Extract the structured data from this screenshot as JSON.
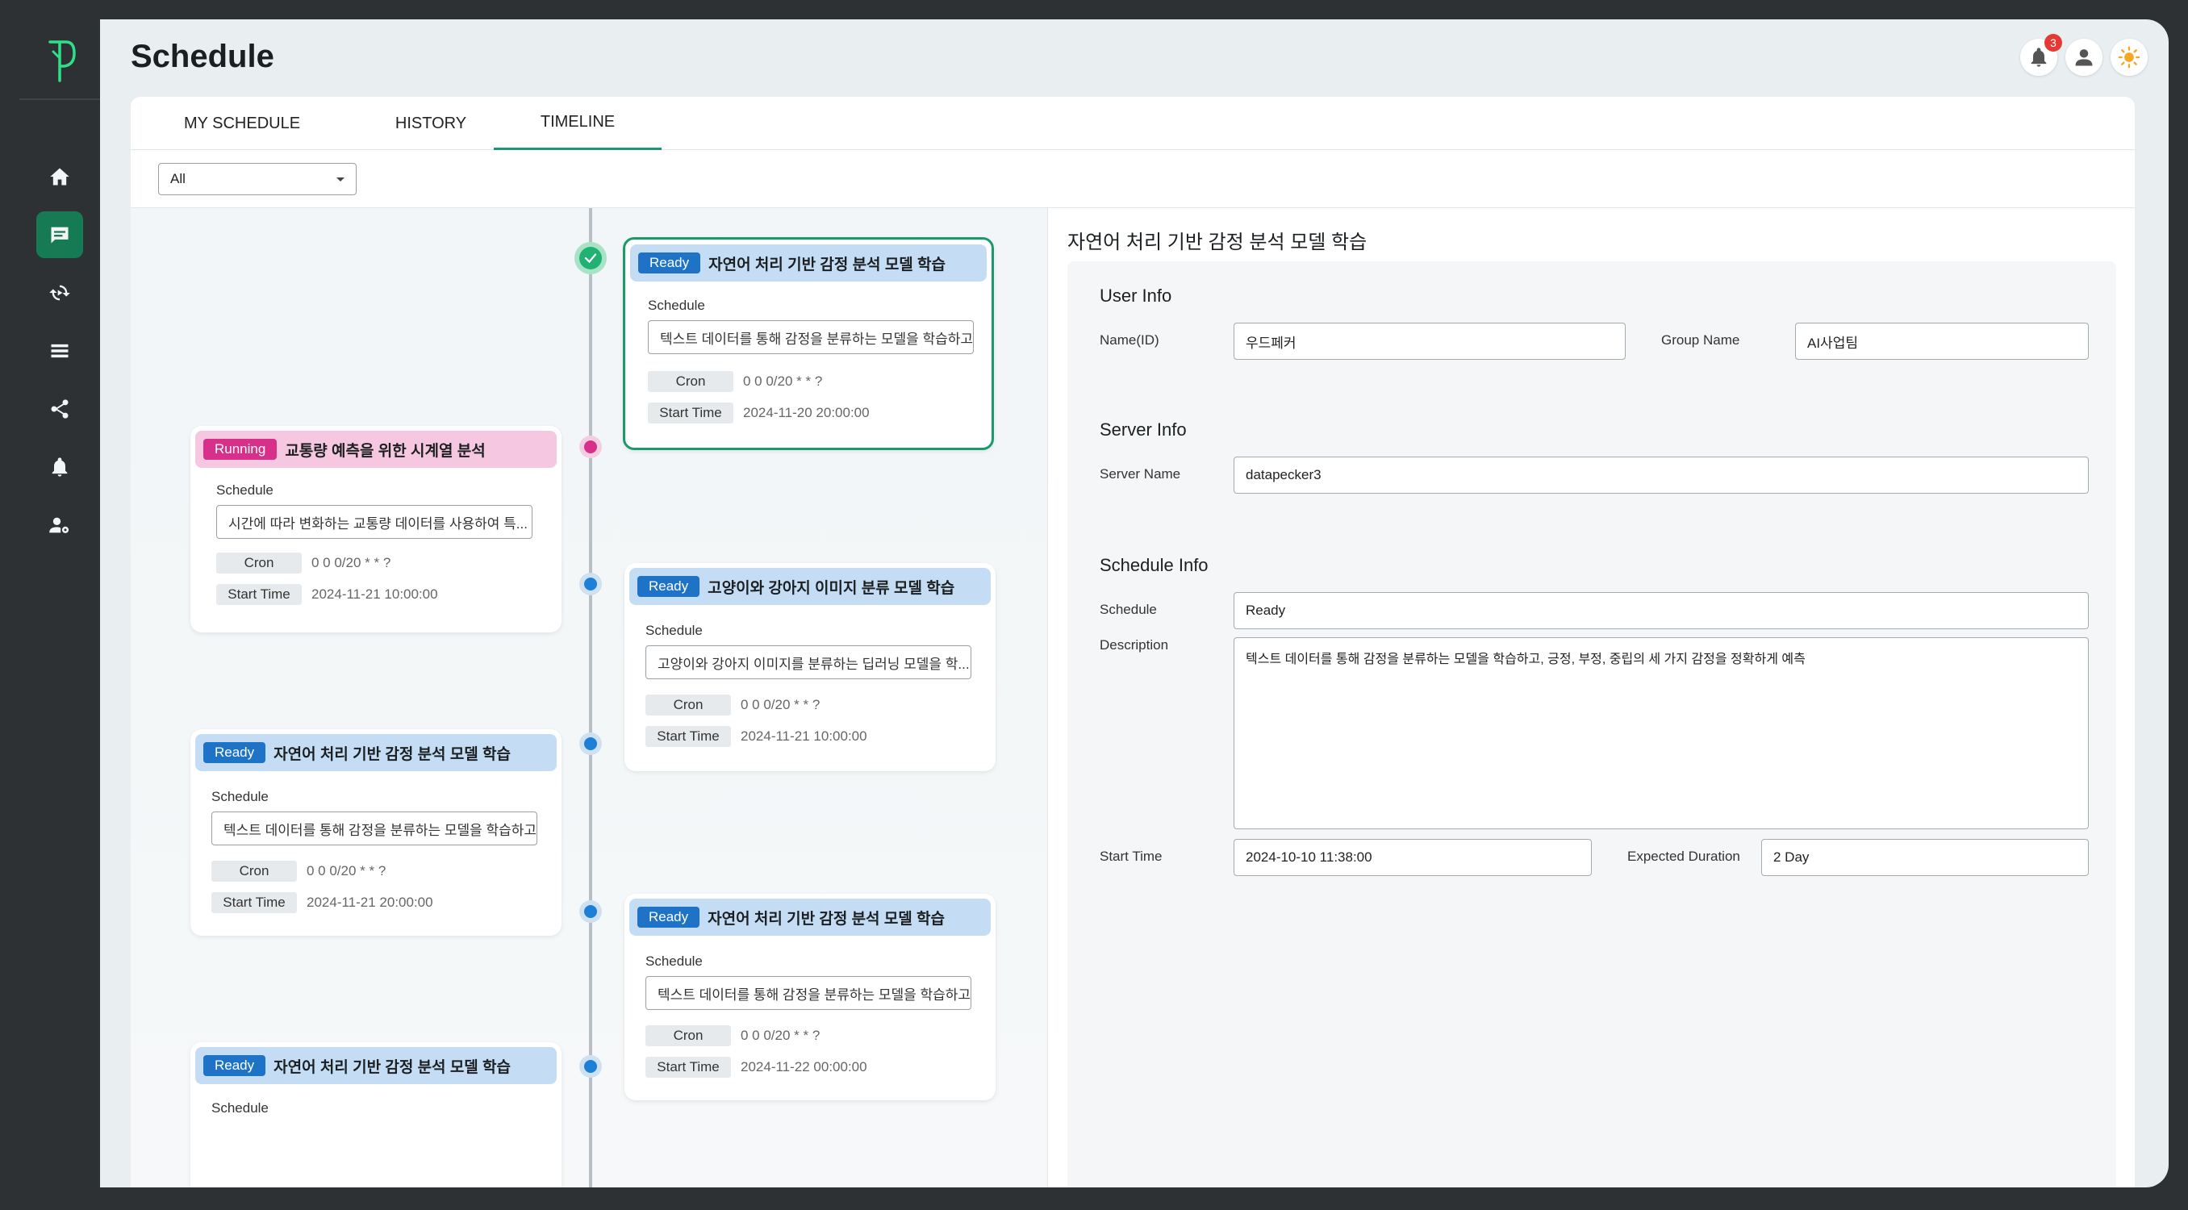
{
  "page": {
    "title": "Schedule"
  },
  "header": {
    "notification_count": "3"
  },
  "tabs": [
    {
      "label": "MY SCHEDULE"
    },
    {
      "label": "HISTORY"
    },
    {
      "label": "TIMELINE"
    }
  ],
  "filter": {
    "selected": "All"
  },
  "sidebar": {
    "items": [
      "home-icon",
      "schedule-icon",
      "sync-icon",
      "list-icon",
      "share-icon",
      "bell-icon",
      "user-settings-icon"
    ]
  },
  "cards": [
    {
      "status": "Ready",
      "title": "자연어 처리 기반 감정 분석 모델 학습",
      "schedule_label": "Schedule",
      "schedule": "텍스트 데이터를 통해 감정을 분류하는 모델을 학습하고,",
      "cron_label": "Cron",
      "cron": "0 0 0/20 * * ?",
      "start_label": "Start Time",
      "start": "2024-11-20 20:00:00"
    },
    {
      "status": "Running",
      "title": "교통량 예측을 위한 시계열 분석",
      "schedule_label": "Schedule",
      "schedule": "시간에 따라 변화하는 교통량 데이터를 사용하여 특...",
      "cron_label": "Cron",
      "cron": "0 0 0/20 * * ?",
      "start_label": "Start Time",
      "start": "2024-11-21 10:00:00"
    },
    {
      "status": "Ready",
      "title": "고양이와 강아지 이미지 분류 모델 학습",
      "schedule_label": "Schedule",
      "schedule": "고양이와 강아지 이미지를 분류하는 딥러닝 모델을 학...",
      "cron_label": "Cron",
      "cron": "0 0 0/20 * * ?",
      "start_label": "Start Time",
      "start": "2024-11-21 10:00:00"
    },
    {
      "status": "Ready",
      "title": "자연어 처리 기반 감정 분석 모델 학습",
      "schedule_label": "Schedule",
      "schedule": "텍스트 데이터를 통해 감정을 분류하는 모델을 학습하고,",
      "cron_label": "Cron",
      "cron": "0 0 0/20 * * ?",
      "start_label": "Start Time",
      "start": "2024-11-21 20:00:00"
    },
    {
      "status": "Ready",
      "title": "자연어 처리 기반 감정 분석 모델 학습",
      "schedule_label": "Schedule",
      "schedule": "텍스트 데이터를 통해 감정을 분류하는 모델을 학습하고,",
      "cron_label": "Cron",
      "cron": "0 0 0/20 * * ?",
      "start_label": "Start Time",
      "start": "2024-11-22 00:00:00"
    },
    {
      "status": "Ready",
      "title": "자연어 처리 기반 감정 분석 모델 학습",
      "schedule_label": "Schedule"
    }
  ],
  "detail": {
    "title": "자연어 처리 기반 감정 분석 모델 학습",
    "user_info": {
      "heading": "User Info",
      "name_label": "Name(ID)",
      "name": "우드페커",
      "group_label": "Group Name",
      "group": "AI사업팀"
    },
    "server_info": {
      "heading": "Server Info",
      "server_label": "Server Name",
      "server": "datapecker3"
    },
    "schedule_info": {
      "heading": "Schedule Info",
      "schedule_label": "Schedule",
      "schedule": "Ready",
      "description_label": "Description",
      "description": "텍스트 데이터를 통해 감정을 분류하는 모델을 학습하고, 긍정, 부정, 중립의 세 가지 감정을 정확하게 예측",
      "start_label": "Start Time",
      "start": "2024-10-10 11:38:00",
      "duration_label": "Expected Duration",
      "duration": "2 Day"
    }
  },
  "colors": {
    "accent": "#1a9a6a",
    "ready": "#1f73c6",
    "running": "#d6308a",
    "sidebar": "#2d3133"
  }
}
